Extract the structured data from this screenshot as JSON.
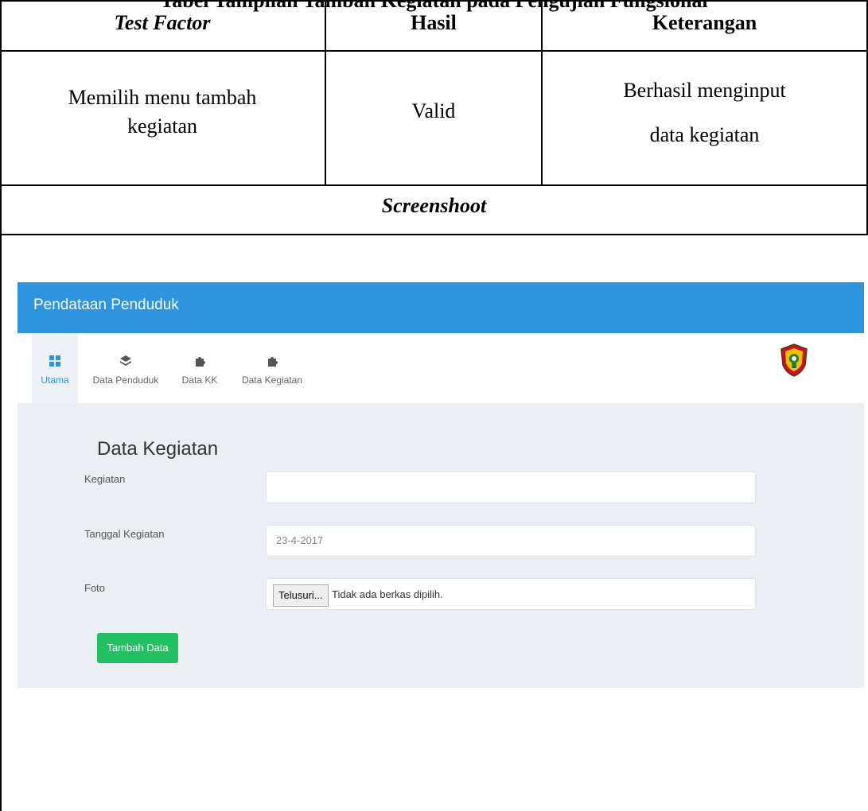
{
  "document": {
    "cut_title": "Tabel Tampilan Tambah Kegiatan pada Pengujian Fungsional"
  },
  "table": {
    "headers": {
      "test_factor": "Test Factor",
      "hasil": "Hasil",
      "keterangan": "Keterangan"
    },
    "row": {
      "test_factor_line1": "Memilih menu tambah",
      "test_factor_line2": "kegiatan",
      "hasil": "Valid",
      "keterangan_line1": "Berhasil menginput",
      "keterangan_line2": "data kegiatan"
    },
    "screenshot_label": "Screenshoot"
  },
  "app": {
    "title": "Pendataan Penduduk",
    "header_color": "#2f94de",
    "nav": [
      {
        "label": "Utama",
        "icon": "dashboard-icon",
        "active": true
      },
      {
        "label": "Data Penduduk",
        "icon": "layers-icon",
        "active": false
      },
      {
        "label": "Data KK",
        "icon": "puzzle-icon",
        "active": false
      },
      {
        "label": "Data Kegiatan",
        "icon": "puzzle-icon",
        "active": false
      }
    ],
    "logo": "regional-emblem-logo",
    "form": {
      "title": "Data Kegiatan",
      "kegiatan_label": "Kegiatan",
      "kegiatan_value": "",
      "tanggal_label": "Tanggal Kegiatan",
      "tanggal_value": "23-4-2017",
      "foto_label": "Foto",
      "file_button": "Telusuri...",
      "file_status": "Tidak ada berkas dipilih.",
      "submit": "Tambah Data",
      "submit_color": "#21c063"
    }
  }
}
